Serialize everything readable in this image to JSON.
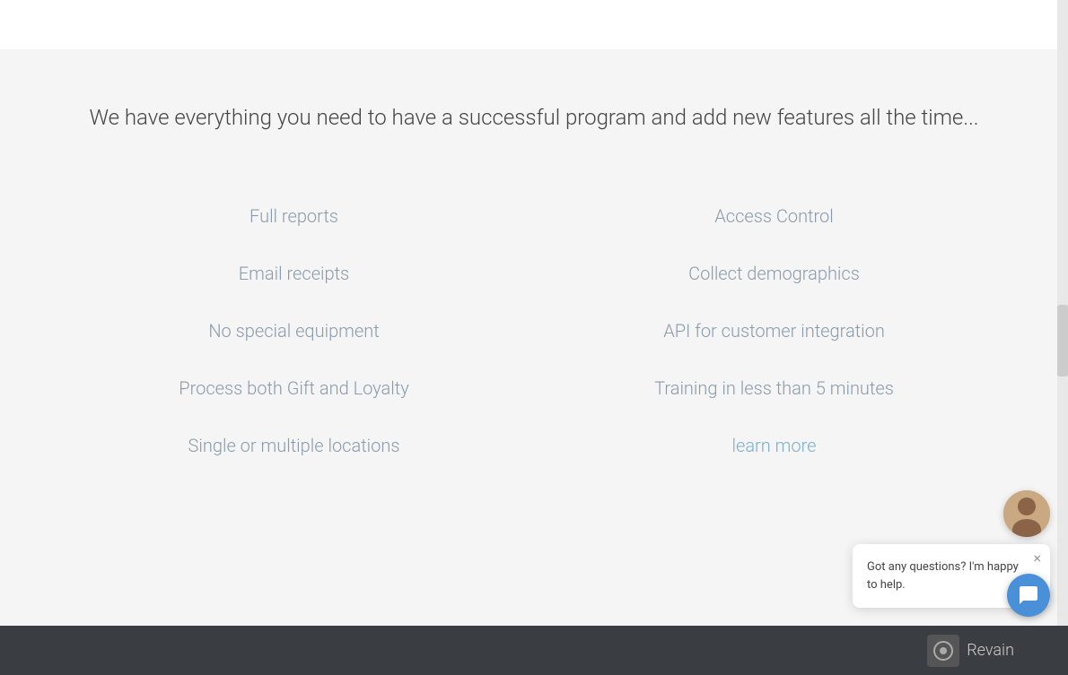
{
  "topBar": {
    "visible": true
  },
  "headline": "We have everything you need to have a successful program and add new features all the time...",
  "featuresLeft": {
    "items": [
      "Full reports",
      "Email receipts",
      "No special equipment",
      "Process both Gift and Loyalty",
      "Single or multiple locations"
    ]
  },
  "featuresRight": {
    "items": [
      "Access Control",
      "Collect demographics",
      "API for customer integration",
      "Training in less than 5 minutes"
    ],
    "learnMoreLabel": "learn more"
  },
  "chatWidget": {
    "messageText": "Got any questions? I'm happy to help.",
    "closeIcon": "×"
  },
  "footer": {
    "logoText": "Revain"
  }
}
